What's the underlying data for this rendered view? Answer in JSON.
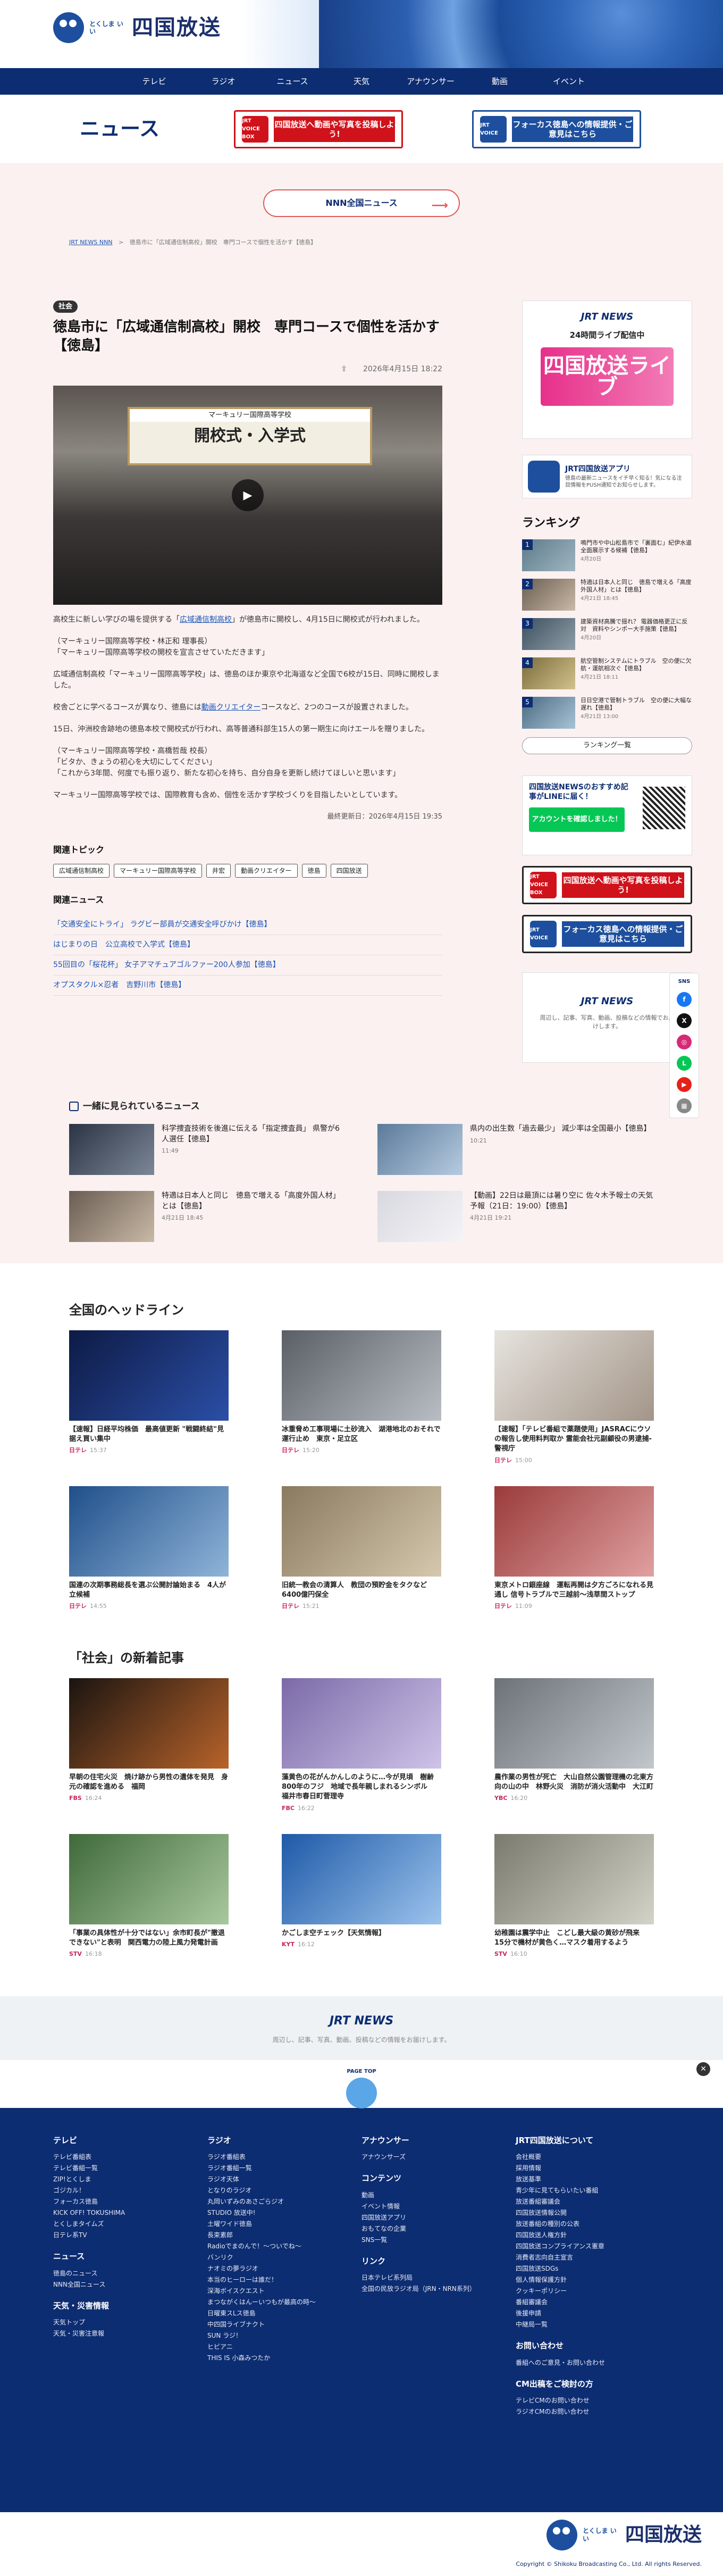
{
  "header": {
    "logo_sub": "とくしま いい",
    "logo_main": "四国放送"
  },
  "nav": [
    "テレビ",
    "ラジオ",
    "ニュース",
    "天気",
    "アナウンサー",
    "動画",
    "イベント"
  ],
  "section": {
    "title": "ニュース"
  },
  "banners": {
    "red": {
      "icon": "JRT VOICE BOX",
      "text": "四国放送へ動画や写真を投稿しよう!"
    },
    "blue": {
      "icon": "JRT VOICE",
      "text": "フォーカス徳島への情報提供・ご意見はこちら"
    }
  },
  "nnn_button": "NNN全国ニュース",
  "breadcrumb": [
    "JRT NEWS NNN",
    "徳島市に「広域通信制高校」開校　専門コースで個性を活かす【徳島】"
  ],
  "article": {
    "category": "社会",
    "title": "徳島市に「広域通信制高校」開校　専門コースで個性を活かす【徳島】",
    "date": "2026年4月15日 18:22",
    "video_board": "開校式・入学式",
    "video_banner": "マーキュリー国際高等学校",
    "p1_pre": "高校生に新しい学びの場を提供する「",
    "p1_link": "広域通信制高校",
    "p1_post": "」が徳島市に開校し、4月15日に開校式が行われました。",
    "p2": "（マーキュリー国際高等学校・林正和 理事長）\n「マーキュリー国際高等学校の開校を宣言させていただきます」",
    "p3": "広域通信制高校「マーキュリー国際高等学校」は、徳島のほか東京や北海道など全国で6校が15日、同時に開校しました。",
    "p4_pre": "校舎ごとに学べるコースが異なり、徳島には",
    "p4_link": "動画クリエイター",
    "p4_post": "コースなど、2つのコースが設置されました。",
    "p5": "15日、沖洲校舎跡地の徳島本校で開校式が行われ、高等普通科部生15人の第一期生に向けエールを贈りました。",
    "p6": "（マーキュリー国際高等学校・高橋哲哉 校長）\n「ビタか、きょうの初心を大切にしてください」\n「これから3年間、何度でも振り返り、新たな初心を持ち、自分自身を更新し続けてほしいと思います」",
    "p7": "マーキュリー国際高等学校では、国際教育も含め、個性を活かす学校づくりを目指したいとしています。",
    "updated": "最終更新日：2026年4月15日 19:35"
  },
  "topics": {
    "title": "関連トピック",
    "tags": [
      "広域通信制高校",
      "マーキュリー国際高等学校",
      "井宏",
      "動画クリエイター",
      "徳島",
      "四国放送"
    ]
  },
  "related": {
    "title": "関連ニュース",
    "items": [
      "「交通安全にトライ」 ラグビー部員が交通安全呼びかけ【徳島】",
      "はじまりの日　公立高校で入学式【徳島】",
      "55回目の「桜花杯」 女子アマチュアゴルファー200人参加【徳島】",
      "オプスタクル×忍者　吉野川市【徳島】"
    ]
  },
  "side": {
    "live_brand": "JRT NEWS",
    "live_24": "24時間ライブ配信中",
    "live_big": "四国放送ライブ",
    "app_title": "JRT四国放送アプリ",
    "app_desc": "徳島の最新ニュースをイチ早く知る！気になる注目情報をPUSH通知でお知らせします。",
    "ranking_title": "ランキング",
    "ranking": [
      {
        "no": "1",
        "text": "鳴門市や中山松島市で「裏面む」紀伊水道全面展示する候補【徳島】",
        "date": "4月20日"
      },
      {
        "no": "2",
        "text": "特適は日本人と同じ　徳島で増える「高度外国人材」とは【徳島】",
        "date": "4月21日 18:45"
      },
      {
        "no": "3",
        "text": "建築資材高騰で揺れ？ 電器価格更正に反対　資料やシンポー大手施策【徳島】",
        "date": "4月20日"
      },
      {
        "no": "4",
        "text": "航空管制システムにトラブル　空の便に欠航・運航相次ぐ【徳島】",
        "date": "4月21日 18:11"
      },
      {
        "no": "5",
        "text": "日日空港で管制トラブル　空の便に大幅な遅れ【徳島】",
        "date": "4月21日 13:00"
      }
    ],
    "ranking_more": "ランキング一覧",
    "line_title": "四国放送NEWSのおすすめ記事がLINEに届く！",
    "line_btn": "アカウントを確認しました！",
    "sns_brand": "JRT NEWS",
    "sns_desc": "周辺し、記事、写真、動画、投稿などの情報でお届けします。",
    "sns_label": "SNS"
  },
  "widely": {
    "title": "一緒に見られているニュース",
    "items": [
      {
        "text": "科学捜査技術を後進に伝える「指定捜査員」 県警が6人選任【徳島】",
        "date": "11:49"
      },
      {
        "text": "県内の出生数「過去最少」 減少率は全国最小【徳島】",
        "date": "10:21"
      },
      {
        "text": "特適は日本人と同じ　徳島で増える「高度外国人材」とは【徳島】",
        "date": "4月21日 18:45"
      },
      {
        "text": "【動画】22日は最頂には暑り空に 佐々木予報士の天気予報（21日：19:00）【徳島】",
        "date": "4月21日 19:21"
      }
    ]
  },
  "national": {
    "title": "全国のヘッドライン",
    "items": [
      {
        "text": "【速報】日経平均株価　最高値更新 \"戦闘終結\"見据え買い集中",
        "src": "日テレ",
        "date": "15:37"
      },
      {
        "text": "冰重脅め工事現場に土砂流入　湖港地北のおそれで運行止め　東京・足立区",
        "src": "日テレ",
        "date": "15:20"
      },
      {
        "text": "【速報】「テレビ番組で薬題使用」JASRACにウソの報告し使用料判取か 霊能会社元副顧役の男逮捕-警視庁",
        "src": "日テレ",
        "date": "15:00"
      },
      {
        "text": "国連の次期事務総長を選ぶ公開討論始まる　4人が立候補",
        "src": "日テレ",
        "date": "14:55"
      },
      {
        "text": "旧統一教会の清算人　教団の預貯金をタクなど6400億円保全",
        "src": "日テレ",
        "date": "15:21"
      },
      {
        "text": "東京メトロ銀座線　運転再開は夕方ごろになれる見通し 信号トラブルで三越前〜浅草間ストップ",
        "src": "日テレ",
        "date": "11:09"
      }
    ]
  },
  "society": {
    "title": "「社会」の新着記事",
    "items": [
      {
        "text": "早朝の住宅火災　焼け跡から男性の遺体を発見　身元の確認を進める　福岡",
        "src": "FBS",
        "date": "16:24"
      },
      {
        "text": "藻黄色の花がんかんしのように…今が見頃　樹齢800年のフジ　地域で長年親しまれるシンボル　福井市春日町菅理寺",
        "src": "FBC",
        "date": "16:22"
      },
      {
        "text": "農作業の男性が死亡　大山自然公園管理機の北東方向の山の中　林野火災　消防が消火活動中　大江町",
        "src": "YBC",
        "date": "16:20"
      },
      {
        "text": "「事業の具体性が十分ではない」余市町長が\"撤退できない\"と表明　関西電力の陸上風力発電計画",
        "src": "STV",
        "date": "16:18"
      },
      {
        "text": "かごしま空チェック【天気情報】",
        "src": "KYT",
        "date": "16:12"
      },
      {
        "text": "幼稚園は震学中止　こどし最大級の黄砂が飛来　15分で機材が黄色く…マスク着用するよう",
        "src": "STV",
        "date": "16:10"
      }
    ]
  },
  "band": {
    "brand": "JRT NEWS",
    "desc": "周辺し、記事、写真、動画、投稿などの情報をお届けします。"
  },
  "pagetop": "PAGE TOP",
  "footer": {
    "col1": [
      {
        "h": "テレビ",
        "items": [
          "テレビ番組表",
          "テレビ番組一覧",
          "ZIP!とくしま",
          "ゴジカル！",
          "フォーカス徳島",
          "KICK OFF! TOKUSHIMA",
          "とくしまタイムズ",
          "日テレ系TV"
        ]
      },
      {
        "h": "ニュース",
        "items": [
          "徳島のニュース",
          "NNN全国ニュース"
        ]
      },
      {
        "h": "天気・災害情報",
        "items": [
          "天気トップ",
          "天気・災害注意報"
        ]
      }
    ],
    "col2": [
      {
        "h": "ラジオ",
        "items": [
          "ラジオ番組表",
          "ラジオ番組一覧",
          "ラジオ天体",
          "となりのラジオ",
          "丸岡いずみのあさごらジオ",
          "STUDIO 放送中!",
          "土曜ワイド徳島",
          "長束素郎",
          "Radioでまのんで！〜ついでね〜",
          "バンリク",
          "ナオミの夢ラジオ",
          "本当のヒーローは誰だ！",
          "深海ボイスクエスト",
          "まつながくはんーいつもが最高の時〜",
          "日曜東スLス徳島",
          "中四国ライブナクト",
          "SUN ラジ！",
          "ヒビアニ",
          "THIS IS 小森みつたか"
        ]
      }
    ],
    "col3": [
      {
        "h": "アナウンサー",
        "items": [
          "アナウンサーズ"
        ]
      },
      {
        "h": "コンテンツ",
        "items": [
          "動画",
          "イベント情報",
          "四国放送アプリ",
          "おもてなの企業",
          "SNS一覧"
        ]
      },
      {
        "h": "リンク",
        "items": [
          "日本テレビ系列局",
          "全国の民放ラジオ局（JRN・NRN系列）"
        ]
      }
    ],
    "col4": [
      {
        "h": "JRT四国放送について",
        "items": [
          "会社概要",
          "採用情報",
          "放送基準",
          "青少年に見てもらいたい番組",
          "放送番組審議会",
          "四国放送情報公開",
          "放送番組の種別の公表",
          "四国放送人権方針",
          "四国放送コンプライアンス憲章",
          "消費者志向自主宣言",
          "四国放送SDGs",
          "個人情報保護方針",
          "クッキーポリシー",
          "番組審議会",
          "後援申請",
          "中継局一覧"
        ]
      },
      {
        "h": "お問い合わせ",
        "items": [
          "番組へのご意見・お問い合わせ"
        ]
      },
      {
        "h": "CM出稿をご検討の方",
        "items": [
          "テレビCMのお問い合わせ",
          "ラジオCMのお問い合わせ"
        ]
      }
    ],
    "logo": "四国放送",
    "logo_sub": "とくしま いい",
    "copyright": "Copyright © Shikoku Broadcasting Co., Ltd. All rights Reserved."
  }
}
